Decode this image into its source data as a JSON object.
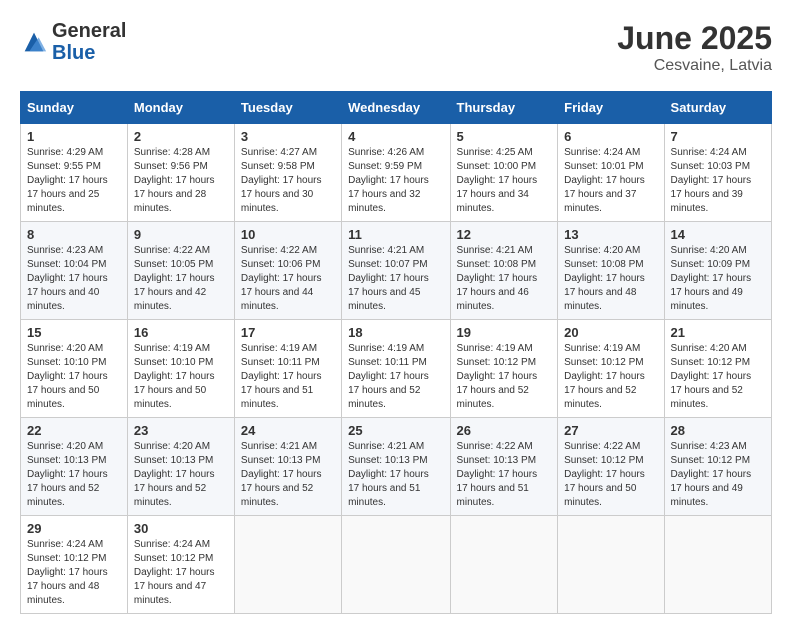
{
  "header": {
    "logo_general": "General",
    "logo_blue": "Blue",
    "month": "June 2025",
    "location": "Cesvaine, Latvia"
  },
  "days_of_week": [
    "Sunday",
    "Monday",
    "Tuesday",
    "Wednesday",
    "Thursday",
    "Friday",
    "Saturday"
  ],
  "weeks": [
    [
      {
        "day": "1",
        "sunrise": "4:29 AM",
        "sunset": "9:55 PM",
        "daylight": "17 hours and 25 minutes."
      },
      {
        "day": "2",
        "sunrise": "4:28 AM",
        "sunset": "9:56 PM",
        "daylight": "17 hours and 28 minutes."
      },
      {
        "day": "3",
        "sunrise": "4:27 AM",
        "sunset": "9:58 PM",
        "daylight": "17 hours and 30 minutes."
      },
      {
        "day": "4",
        "sunrise": "4:26 AM",
        "sunset": "9:59 PM",
        "daylight": "17 hours and 32 minutes."
      },
      {
        "day": "5",
        "sunrise": "4:25 AM",
        "sunset": "10:00 PM",
        "daylight": "17 hours and 34 minutes."
      },
      {
        "day": "6",
        "sunrise": "4:24 AM",
        "sunset": "10:01 PM",
        "daylight": "17 hours and 37 minutes."
      },
      {
        "day": "7",
        "sunrise": "4:24 AM",
        "sunset": "10:03 PM",
        "daylight": "17 hours and 39 minutes."
      }
    ],
    [
      {
        "day": "8",
        "sunrise": "4:23 AM",
        "sunset": "10:04 PM",
        "daylight": "17 hours and 40 minutes."
      },
      {
        "day": "9",
        "sunrise": "4:22 AM",
        "sunset": "10:05 PM",
        "daylight": "17 hours and 42 minutes."
      },
      {
        "day": "10",
        "sunrise": "4:22 AM",
        "sunset": "10:06 PM",
        "daylight": "17 hours and 44 minutes."
      },
      {
        "day": "11",
        "sunrise": "4:21 AM",
        "sunset": "10:07 PM",
        "daylight": "17 hours and 45 minutes."
      },
      {
        "day": "12",
        "sunrise": "4:21 AM",
        "sunset": "10:08 PM",
        "daylight": "17 hours and 46 minutes."
      },
      {
        "day": "13",
        "sunrise": "4:20 AM",
        "sunset": "10:08 PM",
        "daylight": "17 hours and 48 minutes."
      },
      {
        "day": "14",
        "sunrise": "4:20 AM",
        "sunset": "10:09 PM",
        "daylight": "17 hours and 49 minutes."
      }
    ],
    [
      {
        "day": "15",
        "sunrise": "4:20 AM",
        "sunset": "10:10 PM",
        "daylight": "17 hours and 50 minutes."
      },
      {
        "day": "16",
        "sunrise": "4:19 AM",
        "sunset": "10:10 PM",
        "daylight": "17 hours and 50 minutes."
      },
      {
        "day": "17",
        "sunrise": "4:19 AM",
        "sunset": "10:11 PM",
        "daylight": "17 hours and 51 minutes."
      },
      {
        "day": "18",
        "sunrise": "4:19 AM",
        "sunset": "10:11 PM",
        "daylight": "17 hours and 52 minutes."
      },
      {
        "day": "19",
        "sunrise": "4:19 AM",
        "sunset": "10:12 PM",
        "daylight": "17 hours and 52 minutes."
      },
      {
        "day": "20",
        "sunrise": "4:19 AM",
        "sunset": "10:12 PM",
        "daylight": "17 hours and 52 minutes."
      },
      {
        "day": "21",
        "sunrise": "4:20 AM",
        "sunset": "10:12 PM",
        "daylight": "17 hours and 52 minutes."
      }
    ],
    [
      {
        "day": "22",
        "sunrise": "4:20 AM",
        "sunset": "10:13 PM",
        "daylight": "17 hours and 52 minutes."
      },
      {
        "day": "23",
        "sunrise": "4:20 AM",
        "sunset": "10:13 PM",
        "daylight": "17 hours and 52 minutes."
      },
      {
        "day": "24",
        "sunrise": "4:21 AM",
        "sunset": "10:13 PM",
        "daylight": "17 hours and 52 minutes."
      },
      {
        "day": "25",
        "sunrise": "4:21 AM",
        "sunset": "10:13 PM",
        "daylight": "17 hours and 51 minutes."
      },
      {
        "day": "26",
        "sunrise": "4:22 AM",
        "sunset": "10:13 PM",
        "daylight": "17 hours and 51 minutes."
      },
      {
        "day": "27",
        "sunrise": "4:22 AM",
        "sunset": "10:12 PM",
        "daylight": "17 hours and 50 minutes."
      },
      {
        "day": "28",
        "sunrise": "4:23 AM",
        "sunset": "10:12 PM",
        "daylight": "17 hours and 49 minutes."
      }
    ],
    [
      {
        "day": "29",
        "sunrise": "4:24 AM",
        "sunset": "10:12 PM",
        "daylight": "17 hours and 48 minutes."
      },
      {
        "day": "30",
        "sunrise": "4:24 AM",
        "sunset": "10:12 PM",
        "daylight": "17 hours and 47 minutes."
      },
      null,
      null,
      null,
      null,
      null
    ]
  ]
}
